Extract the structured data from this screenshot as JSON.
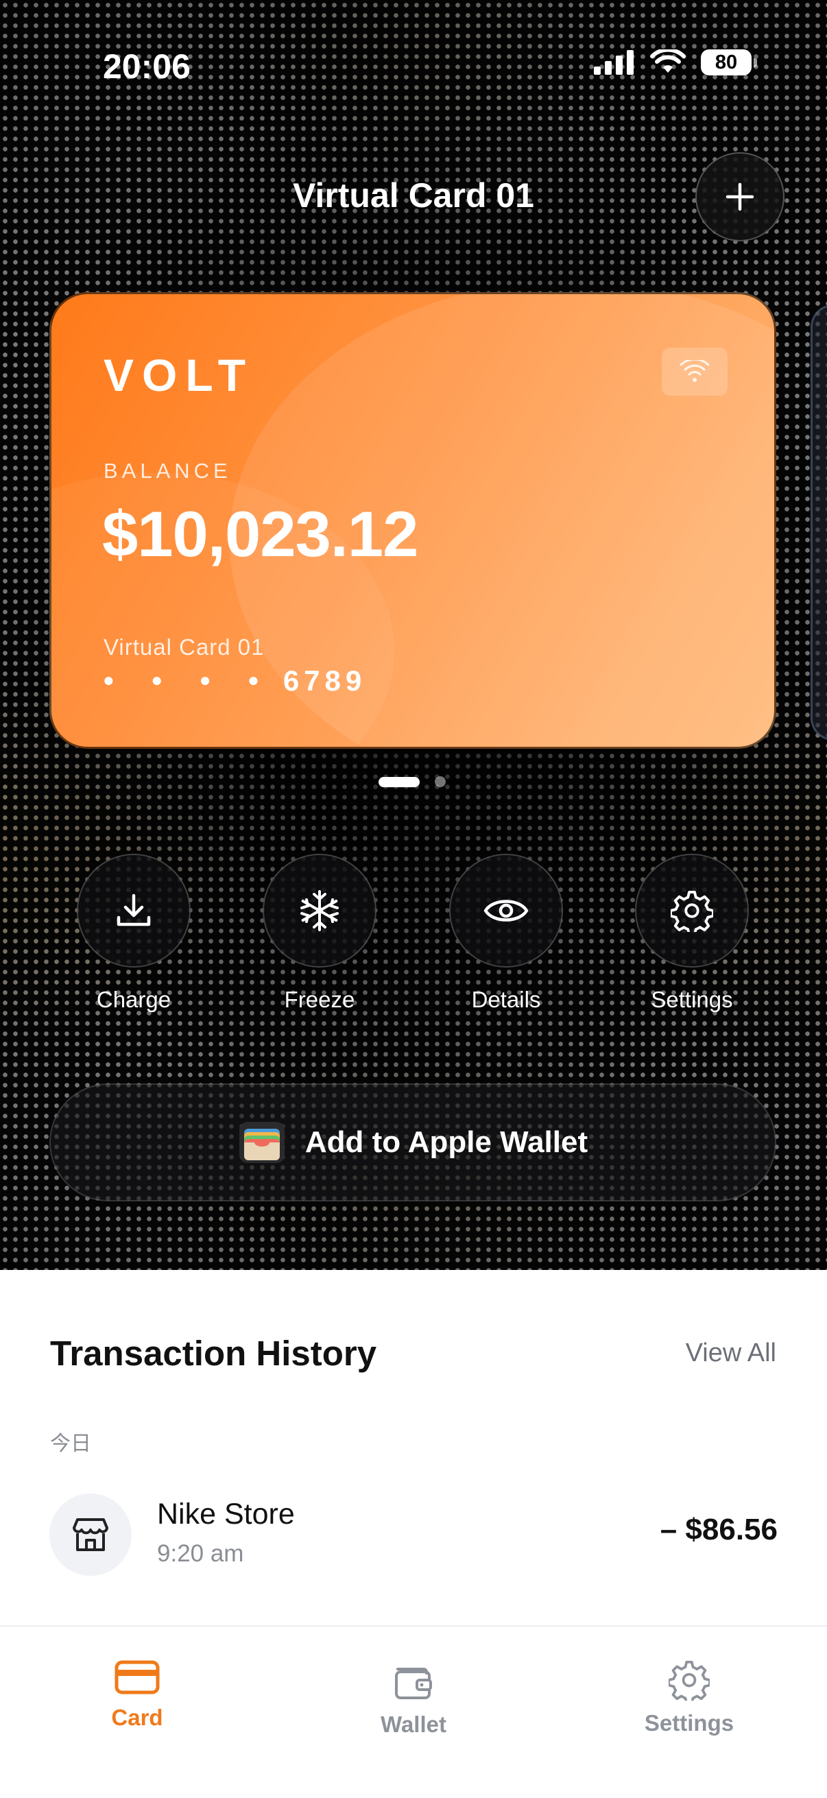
{
  "status_bar": {
    "time": "20:06",
    "battery": "80",
    "icons": [
      "signal-icon",
      "wifi-icon",
      "battery-icon"
    ]
  },
  "header": {
    "title": "Virtual Card 01",
    "add_icon": "plus-icon"
  },
  "card": {
    "brand": "VOLT",
    "balance_label": "BALANCE",
    "balance": "$10,023.12",
    "name": "Virtual Card 01",
    "masked": "• • • •",
    "last4": "6789",
    "contactless_icon": "contactless-icon",
    "gradient": [
      "#ff7a1a",
      "#ffb877"
    ]
  },
  "pager": {
    "count": 2,
    "active": 0
  },
  "actions": [
    {
      "label": "Charge",
      "icon": "download-icon"
    },
    {
      "label": "Freeze",
      "icon": "snowflake-icon"
    },
    {
      "label": "Details",
      "icon": "eye-icon"
    },
    {
      "label": "Settings",
      "icon": "gear-icon"
    }
  ],
  "wallet_button": {
    "label": "Add to Apple Wallet",
    "icon": "apple-wallet-icon"
  },
  "transactions": {
    "title": "Transaction History",
    "view_all": "View All",
    "groups": [
      {
        "date_label": "今日",
        "items": [
          {
            "name": "Nike Store",
            "time": "9:20 am",
            "amount": "– $86.56",
            "icon": "store-icon"
          }
        ]
      }
    ]
  },
  "tabbar": {
    "tabs": [
      {
        "label": "Card",
        "icon": "card-icon",
        "active": true
      },
      {
        "label": "Wallet",
        "icon": "wallet-icon",
        "active": false
      },
      {
        "label": "Settings",
        "icon": "gear-icon",
        "active": false
      }
    ]
  },
  "colors": {
    "accent": "#f07a1a",
    "tab_inactive": "#8e929a",
    "background_dark": "#050505"
  }
}
